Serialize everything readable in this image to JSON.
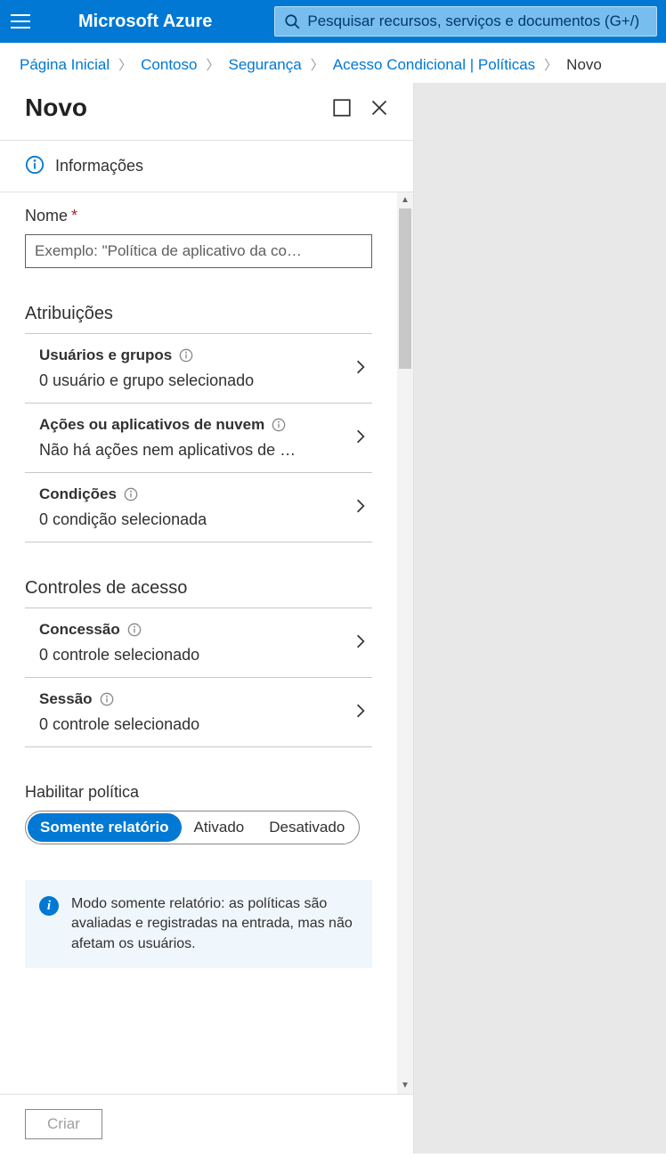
{
  "header": {
    "brand": "Microsoft Azure",
    "search_placeholder": "Pesquisar recursos, serviços e documentos (G+/)"
  },
  "breadcrumb": {
    "items": [
      "Página Inicial",
      "Contoso",
      "Segurança",
      "Acesso Condicional | Políticas"
    ],
    "current": "Novo"
  },
  "panel": {
    "title": "Novo",
    "info_label": "Informações"
  },
  "form": {
    "name_label": "Nome",
    "name_placeholder": "Exemplo: \"Política de aplicativo da co…"
  },
  "sections": {
    "assignments": {
      "title": "Atribuições",
      "items": [
        {
          "title": "Usuários e grupos",
          "sub": "0 usuário e grupo selecionado"
        },
        {
          "title": "Ações ou aplicativos de nuvem",
          "sub": "Não há ações nem aplicativos de …"
        },
        {
          "title": "Condições",
          "sub": "0 condição selecionada"
        }
      ]
    },
    "access": {
      "title": "Controles de acesso",
      "items": [
        {
          "title": "Concessão",
          "sub": "0 controle selecionado"
        },
        {
          "title": "Sessão",
          "sub": "0 controle selecionado"
        }
      ]
    }
  },
  "enable": {
    "title": "Habilitar política",
    "options": [
      "Somente relatório",
      "Ativado",
      "Desativado"
    ]
  },
  "notice": "Modo somente relatório: as políticas são avaliadas e registradas na entrada, mas não afetam os usuários.",
  "footer": {
    "create": "Criar"
  }
}
